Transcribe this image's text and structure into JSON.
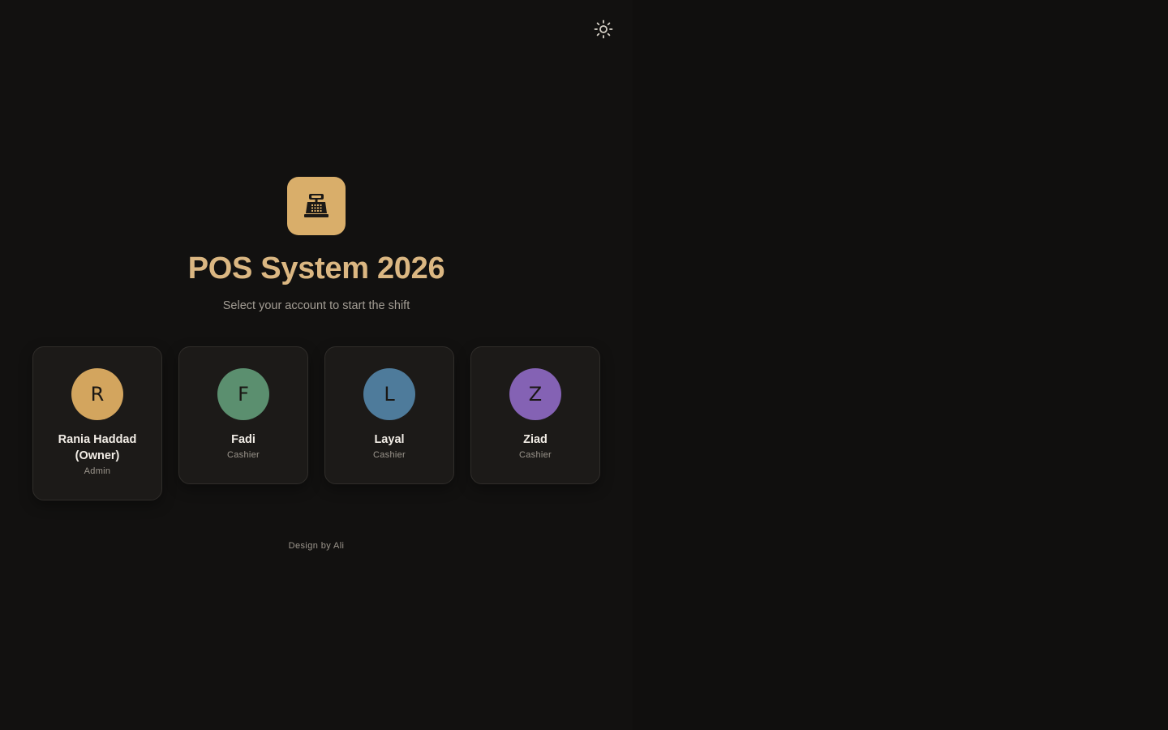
{
  "colors": {
    "accent": "#d9ae6a",
    "title": "#dbb782",
    "background": "#100f0e"
  },
  "header": {
    "theme_toggle_icon": "sun-icon"
  },
  "brand": {
    "logo_icon": "cash-register-icon",
    "title": "POS System 2026",
    "subtitle": "Select your account to start the shift"
  },
  "accounts": [
    {
      "initial": "R",
      "name": "Rania Haddad (Owner)",
      "role": "Admin",
      "color": "#d3a55e"
    },
    {
      "initial": "F",
      "name": "Fadi",
      "role": "Cashier",
      "color": "#5b8f6f"
    },
    {
      "initial": "L",
      "name": "Layal",
      "role": "Cashier",
      "color": "#4e7b9b"
    },
    {
      "initial": "Z",
      "name": "Ziad",
      "role": "Cashier",
      "color": "#8462b4"
    }
  ],
  "footer": {
    "credit": "Design by Ali"
  }
}
